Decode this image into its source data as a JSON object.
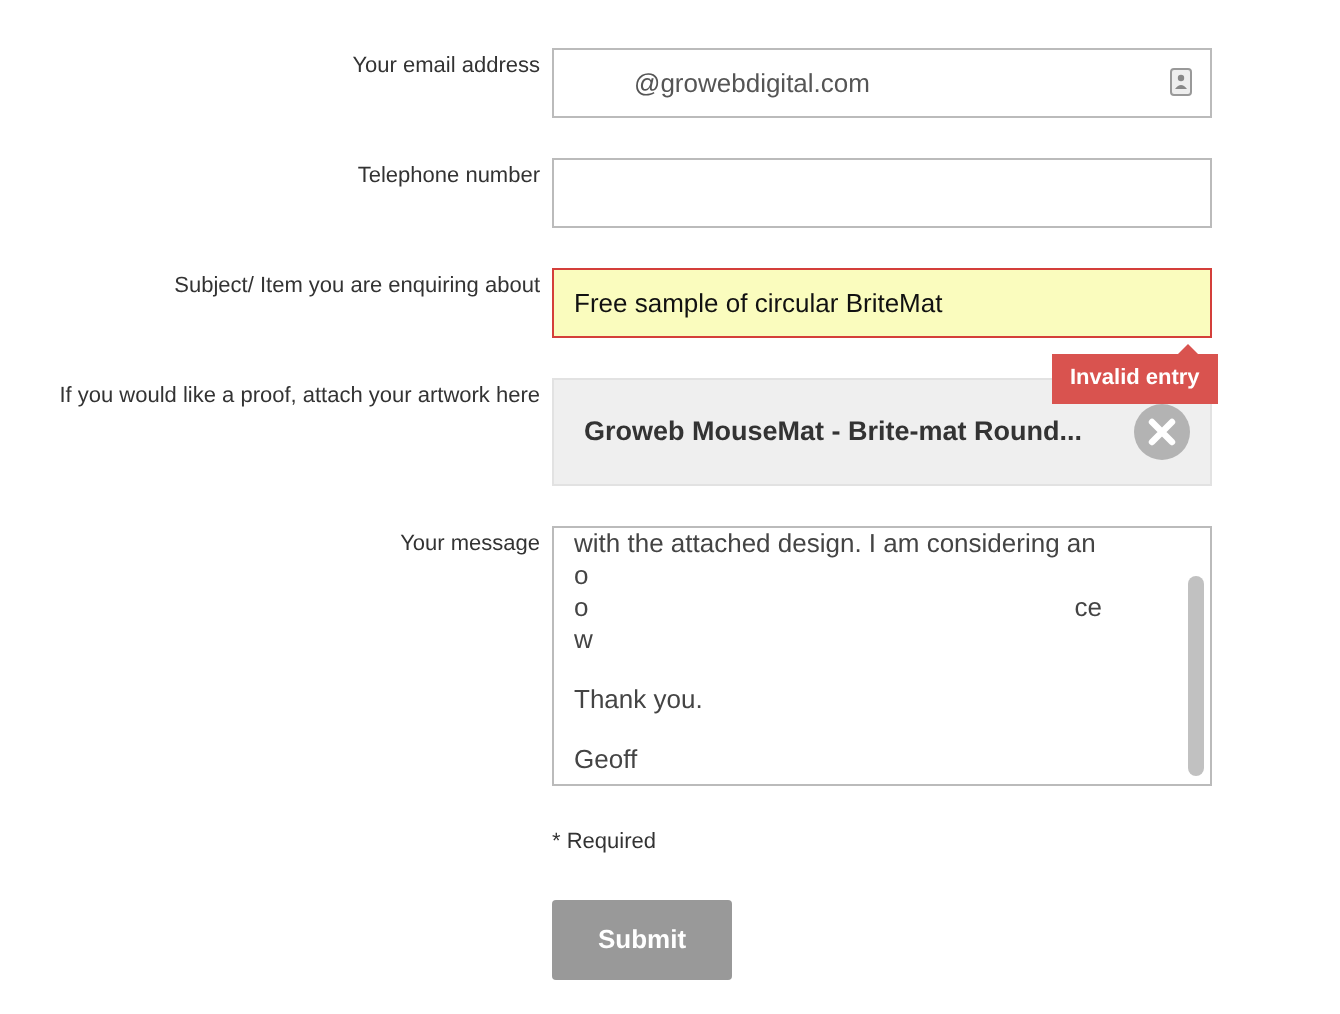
{
  "fields": [
    {
      "kind": "email",
      "label": "Your email address",
      "value": "@growebdigital.com",
      "invalid": false
    },
    {
      "kind": "text",
      "label": "Telephone number",
      "invalid": false
    },
    {
      "kind": "text",
      "label": "Subject/ Item you are enquiring about",
      "value": "Free sample of circular BriteMat",
      "invalid": true,
      "error": "Invalid entry"
    },
    {
      "kind": "file",
      "label": "If you would like a proof, attach your artwork here",
      "filename": "Groweb MouseMat - Brite-mat Round..."
    },
    {
      "kind": "message",
      "label": "Your message",
      "paragraphs": [
        [
          {
            "left": "with the attached design. I am considering an"
          },
          {
            "left": "o"
          },
          {
            "left": "o",
            "right": "ce"
          },
          {
            "left": "w"
          }
        ],
        [
          {
            "left": "Thank you."
          }
        ],
        [
          {
            "left": "Geoff"
          }
        ]
      ]
    }
  ],
  "required_note": "* Required",
  "submit": {
    "label": "Submit",
    "disabled": true
  }
}
